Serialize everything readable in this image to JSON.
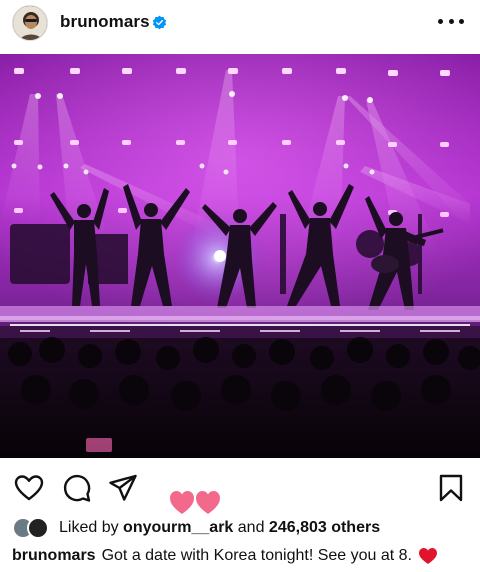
{
  "post": {
    "username": "brunomars",
    "icons": {
      "avatar": "profile-avatar",
      "verified": "verified-badge-icon",
      "more": "more-options-icon"
    },
    "actions": {
      "like": "heart-outline-icon",
      "comment": "comment-bubble-icon",
      "share": "paper-plane-icon",
      "save": "bookmark-icon",
      "floating_reaction": "double-heart-icon"
    },
    "likes": {
      "prefix": "Liked by",
      "liker": "onyourm__ark",
      "connector": "and",
      "count": "246,803 others"
    },
    "caption": {
      "username": "brunomars",
      "text": "Got a date with Korea tonight! See you at 8."
    },
    "colors": {
      "verified_blue": "#0095f6",
      "heart_pink": "#f2698c",
      "caption_heart": "#e0142b",
      "stage_magenta": "#c02cd8"
    }
  }
}
